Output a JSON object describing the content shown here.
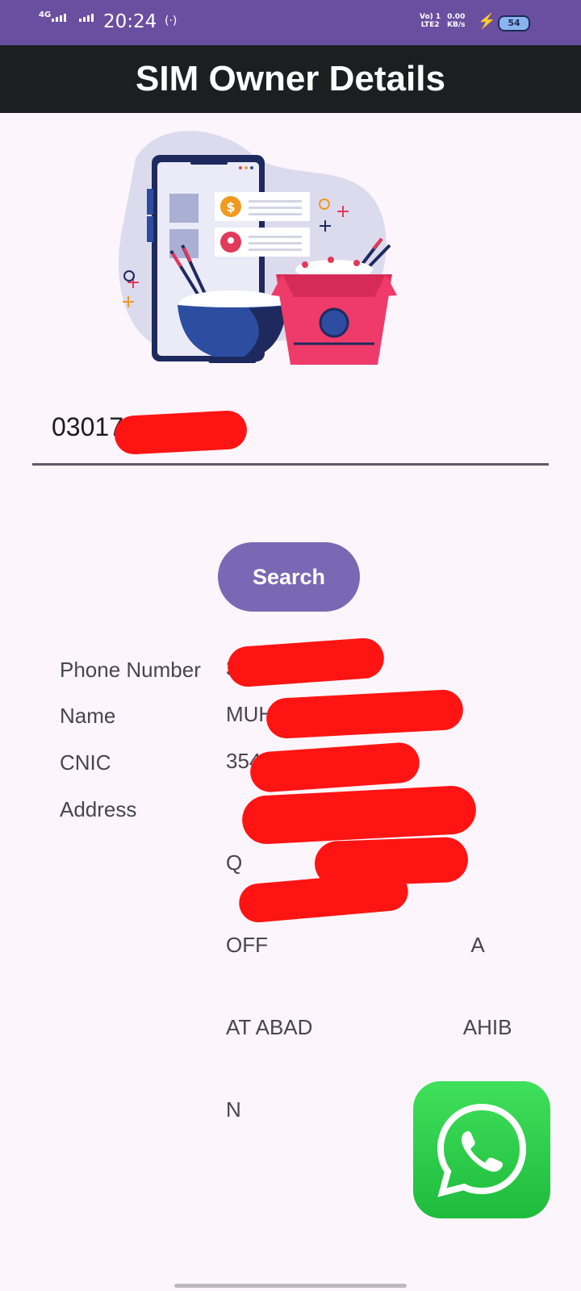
{
  "status_bar": {
    "network_type": "4G",
    "time": "20:24",
    "volte_label_top": "Vo) 1",
    "volte_label_bottom": "LTE2",
    "speed_value": "0.00",
    "speed_unit": "KB/s",
    "battery_level": "54"
  },
  "app_bar": {
    "title": "SIM Owner Details"
  },
  "search": {
    "input_value": "03017",
    "button_label": "Search"
  },
  "details": {
    "phone_label": "Phone Number",
    "phone_value": "3",
    "name_label": "Name",
    "name_value": "MUH",
    "cnic_label": "CNIC",
    "cnic_value": "354",
    "address_label": "Address",
    "address_lines": [
      "Q",
      "OFF                                   A",
      "AT ABAD                          AHIB",
      "N"
    ]
  },
  "colors": {
    "status_bar": "#6a4fa1",
    "app_bar": "#1c1e20",
    "button": "#7b68b4",
    "redaction": "#ff1414",
    "whatsapp": "#25d366"
  }
}
